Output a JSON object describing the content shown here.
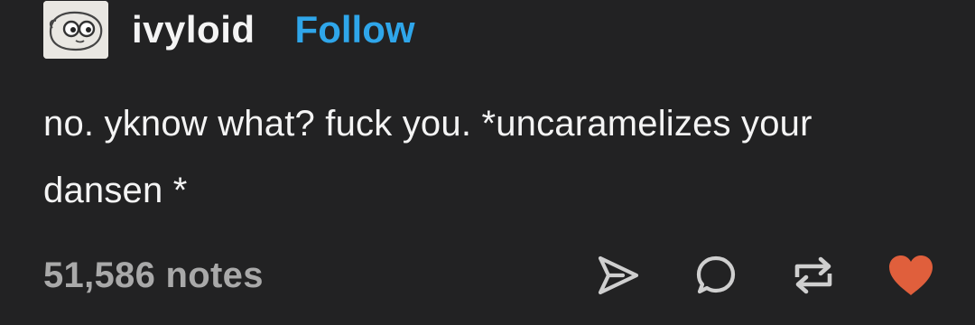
{
  "post": {
    "author": {
      "username": "ivyloid",
      "avatar_icon": "cartoon-eyes-avatar-icon"
    },
    "follow_label": "Follow",
    "body_text": "no. yknow what? fuck you. *uncaramelizes your dansen *",
    "notes_label": "51,586 notes",
    "actions": {
      "share_icon": "send-icon",
      "reply_icon": "comment-icon",
      "reblog_icon": "reblog-icon",
      "like_icon": "heart-icon"
    }
  },
  "colors": {
    "background": "#222223",
    "text": "#f4f4f4",
    "muted": "#a9a9a9",
    "follow": "#2fa6ea",
    "heart": "#e05f3c",
    "icon": "#cfcfcf"
  }
}
